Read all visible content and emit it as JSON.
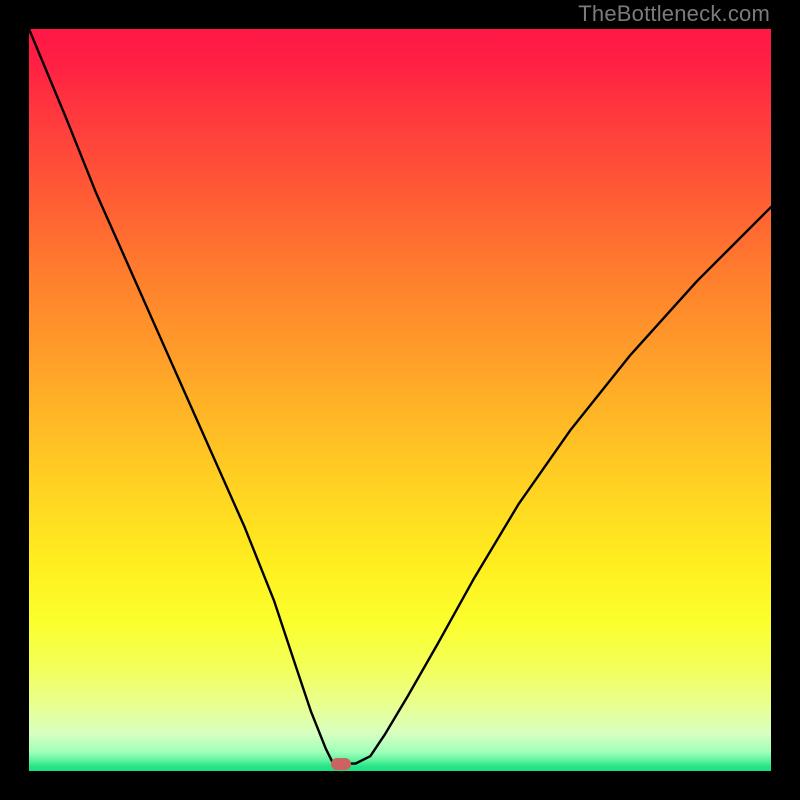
{
  "watermark": "TheBottleneck.com",
  "colors": {
    "frame": "#000000",
    "gradient_top": "#ff1846",
    "gradient_bottom": "#17e181",
    "curve": "#000000",
    "marker": "#cb6362"
  },
  "chart_data": {
    "type": "line",
    "title": "",
    "xlabel": "",
    "ylabel": "",
    "xlim": [
      0,
      100
    ],
    "ylim": [
      0,
      100
    ],
    "grid": false,
    "legend": false,
    "series": [
      {
        "name": "bottleneck-curve",
        "x": [
          0,
          5,
          9,
          13,
          17,
          21,
          25,
          29,
          33,
          36,
          38,
          40,
          41,
          42,
          44,
          46,
          48,
          51,
          55,
          60,
          66,
          73,
          81,
          90,
          100
        ],
        "values": [
          100,
          88,
          78,
          69,
          60,
          51,
          42,
          33,
          23,
          14,
          8,
          3,
          1,
          1,
          1,
          2,
          5,
          10,
          17,
          26,
          36,
          46,
          56,
          66,
          76
        ]
      }
    ],
    "annotations": [
      {
        "name": "optimal-marker",
        "x": 42,
        "y": 1
      }
    ]
  }
}
